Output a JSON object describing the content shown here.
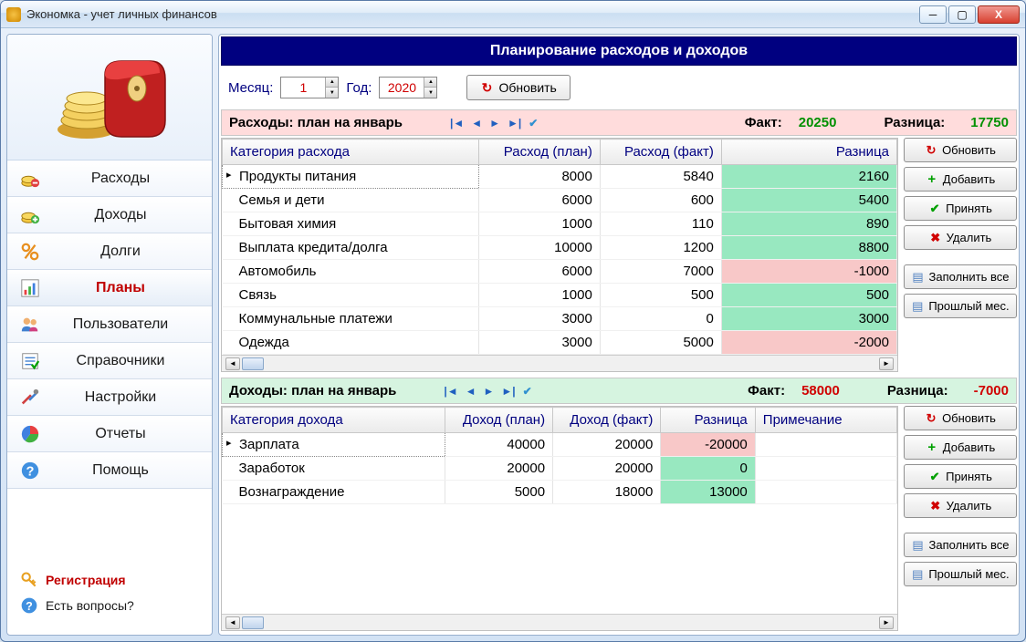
{
  "window": {
    "title": "Экономка - учет личных финансов"
  },
  "sidebar": {
    "items": [
      {
        "label": "Расходы"
      },
      {
        "label": "Доходы"
      },
      {
        "label": "Долги"
      },
      {
        "label": "Планы"
      },
      {
        "label": "Пользователи"
      },
      {
        "label": "Справочники"
      },
      {
        "label": "Настройки"
      },
      {
        "label": "Отчеты"
      },
      {
        "label": "Помощь"
      }
    ],
    "registration": "Регистрация",
    "questions": "Есть вопросы?"
  },
  "main": {
    "title": "Планирование расходов и доходов",
    "month_label": "Месяц:",
    "month_value": "1",
    "year_label": "Год:",
    "year_value": "2020",
    "refresh": "Обновить"
  },
  "expenses": {
    "title": "Расходы: план на январь",
    "fact_label": "Факт:",
    "fact_value": "20250",
    "diff_label": "Разница:",
    "diff_value": "17750",
    "columns": {
      "cat": "Категория расхода",
      "plan": "Расход (план)",
      "fact": "Расход (факт)",
      "diff": "Разница"
    },
    "rows": [
      {
        "cat": "Продукты питания",
        "plan": "8000",
        "fact": "5840",
        "diff": "2160",
        "pos": true
      },
      {
        "cat": "Семья и дети",
        "plan": "6000",
        "fact": "600",
        "diff": "5400",
        "pos": true
      },
      {
        "cat": "Бытовая химия",
        "plan": "1000",
        "fact": "110",
        "diff": "890",
        "pos": true
      },
      {
        "cat": "Выплата кредита/долга",
        "plan": "10000",
        "fact": "1200",
        "diff": "8800",
        "pos": true
      },
      {
        "cat": "Автомобиль",
        "plan": "6000",
        "fact": "7000",
        "diff": "-1000",
        "pos": false
      },
      {
        "cat": "Связь",
        "plan": "1000",
        "fact": "500",
        "diff": "500",
        "pos": true
      },
      {
        "cat": "Коммунальные платежи",
        "plan": "3000",
        "fact": "0",
        "diff": "3000",
        "pos": true
      },
      {
        "cat": "Одежда",
        "plan": "3000",
        "fact": "5000",
        "diff": "-2000",
        "pos": false
      }
    ]
  },
  "incomes": {
    "title": "Доходы: план на январь",
    "fact_label": "Факт:",
    "fact_value": "58000",
    "diff_label": "Разница:",
    "diff_value": "-7000",
    "columns": {
      "cat": "Категория дохода",
      "plan": "Доход (план)",
      "fact": "Доход (факт)",
      "diff": "Разница",
      "note": "Примечание"
    },
    "rows": [
      {
        "cat": "Зарплата",
        "plan": "40000",
        "fact": "20000",
        "diff": "-20000",
        "pos": false
      },
      {
        "cat": "Заработок",
        "plan": "20000",
        "fact": "20000",
        "diff": "0",
        "pos": true
      },
      {
        "cat": "Вознаграждение",
        "plan": "5000",
        "fact": "18000",
        "diff": "13000",
        "pos": true
      }
    ]
  },
  "buttons": {
    "refresh": "Обновить",
    "add": "Добавить",
    "accept": "Принять",
    "delete": "Удалить",
    "fill_all": "Заполнить все",
    "last_month": "Прошлый мес."
  }
}
